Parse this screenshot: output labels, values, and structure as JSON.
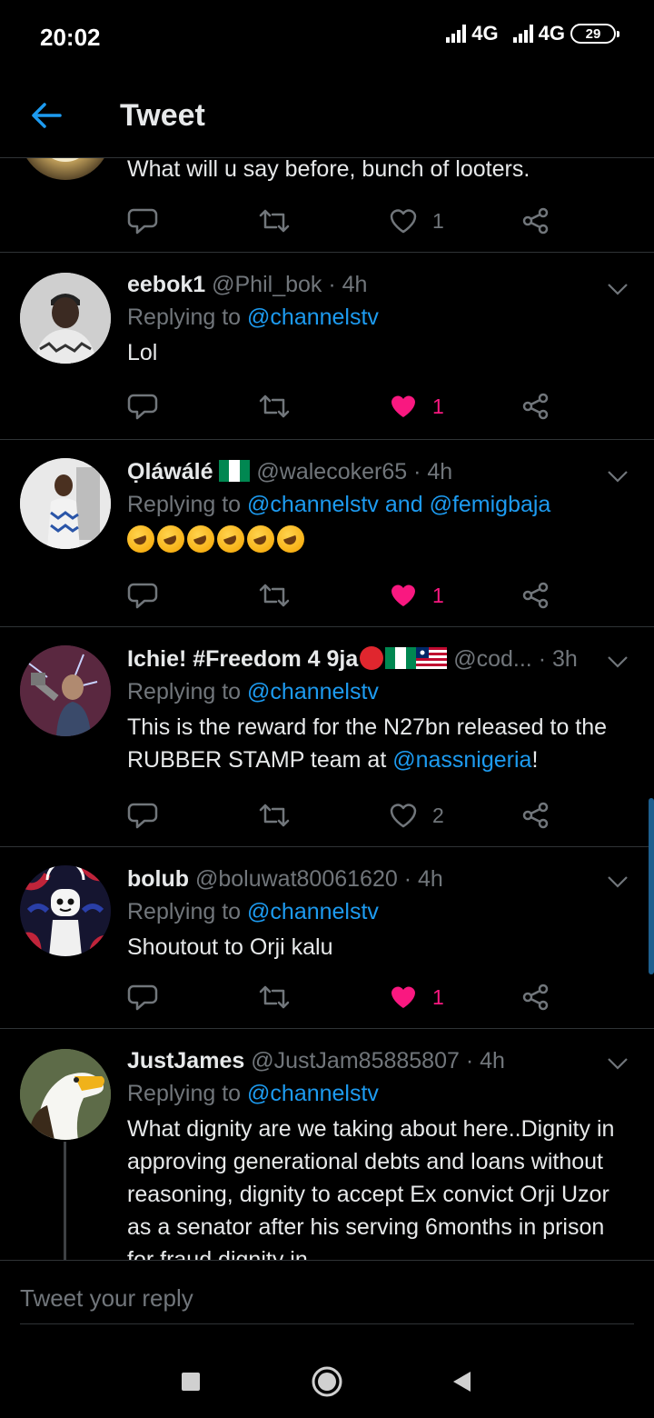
{
  "status_bar": {
    "time": "20:02",
    "network_1": "4G",
    "network_2": "4G",
    "battery": "29"
  },
  "header": {
    "title": "Tweet",
    "back_icon": "arrow-left-icon"
  },
  "colors": {
    "accent": "#1d9bf0",
    "like": "#f91880",
    "muted": "#71767b",
    "divider": "#2f3336"
  },
  "tweets": [
    {
      "text": "What will u say before, bunch of looters.",
      "likes": "1",
      "liked": false
    },
    {
      "name": "eebok1",
      "handle": "@Phil_bok",
      "time": "4h",
      "replying_prefix": "Replying to",
      "mentions": [
        "@channelstv"
      ],
      "text": "Lol",
      "likes": "1",
      "liked": true
    },
    {
      "name": "Ọláwálé",
      "handle": "@walecoker65",
      "time": "4h",
      "replying_prefix": "Replying to",
      "mentions": [
        "@channelstv",
        "@femigbaja"
      ],
      "joiner": "and",
      "text_emoji": "rolling-on-floor-laughing-icon",
      "emoji_count": 6,
      "likes": "1",
      "liked": true
    },
    {
      "name": "Ichie! #Freedom 4 9ja",
      "handle": "@cod...",
      "time": "3h",
      "replying_prefix": "Replying to",
      "mentions": [
        "@channelstv"
      ],
      "text_part1": "This is the reward for the N27bn released to the RUBBER STAMP team at ",
      "text_mention": "@nassnigeria",
      "text_part2": "!",
      "likes": "2",
      "liked": false
    },
    {
      "name": "bolub",
      "handle": "@boluwat80061620",
      "time": "4h",
      "replying_prefix": "Replying to",
      "mentions": [
        "@channelstv"
      ],
      "text": "Shoutout to Orji kalu",
      "likes": "1",
      "liked": true
    },
    {
      "name": "JustJames",
      "handle": "@JustJam85885807",
      "time": "4h",
      "replying_prefix": "Replying to",
      "mentions": [
        "@channelstv"
      ],
      "text": "What dignity are we taking about here..Dignity in approving generational debts and loans without reasoning, dignity to accept Ex convict Orji Uzor as a senator after his serving 6months in prison for fraud,dignity in"
    }
  ],
  "reply_bar": {
    "placeholder": "Tweet your reply"
  },
  "nav": {
    "recents_icon": "square-icon",
    "home_icon": "circle-icon",
    "back_icon": "triangle-back-icon"
  }
}
